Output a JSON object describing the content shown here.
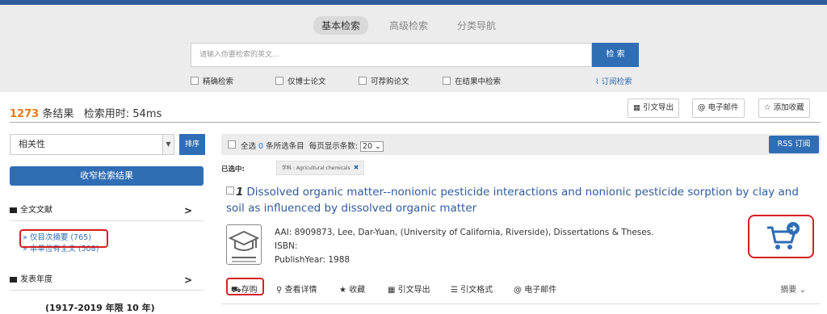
{
  "search": {
    "tabs": [
      "基本检索",
      "高级检索",
      "分类导航"
    ],
    "placeholder": "请输入你要检索的英文...",
    "button": "检 索",
    "options": [
      "精确检索",
      "仅博士论文",
      "可荐购论文",
      "在结果中检索"
    ],
    "subscribe": "订阅检索"
  },
  "results": {
    "count": "1273",
    "count_label": "条结果",
    "time_label": "检索用时:",
    "time_value": "54ms",
    "tools": [
      "引文导出",
      "电子邮件",
      "添加收藏"
    ]
  },
  "sidebar": {
    "sort_value": "相关性",
    "sort_button": "排序",
    "narrow_button": "收窄检索结果",
    "facets": [
      {
        "label": "全文文献",
        "items": [
          "» 仅目次摘要 (765)",
          "» 本单位有全文 (508)"
        ]
      },
      {
        "label": "发表年度",
        "items": []
      }
    ],
    "cut_text": "(1917-2019 年限 10 年)"
  },
  "list": {
    "select_all": "全选",
    "selected_count": "0",
    "selected_text": "条所选条目",
    "per_page_label": "每页显示条数:",
    "per_page_value": "20",
    "rss_button": "RSS 订阅",
    "selected_label": "已选中:",
    "tag": "学科 : Agricultural chemicals"
  },
  "item": {
    "index": "1",
    "title": "Dissolved organic matter--nonionic pesticide interactions and nonionic pesticide sorption by clay and soil as influenced by dissolved organic matter",
    "aai": "AAI: 8909873, Lee, Dar-Yuan, (University of California, Riverside), Dissertations & Theses.",
    "isbn": "ISBN:",
    "year": "PublishYear: 1988",
    "actions": [
      "存购",
      "查看详情",
      "收藏",
      "引文导出",
      "引文格式",
      "电子邮件"
    ],
    "digest": "摘要",
    "accent": "#2f6db5",
    "highlight": "#d62020"
  }
}
